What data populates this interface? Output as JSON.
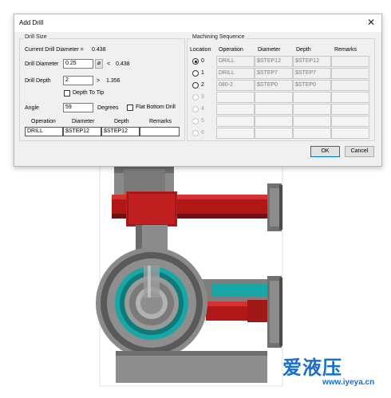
{
  "dialog": {
    "title": "Add Drill",
    "close_glyph": "✕",
    "drill_size": {
      "group_title": "Drill Size",
      "current_diameter_label": "Current Drill Diameter =",
      "current_diameter_value": "0.438",
      "drill_diameter_label": "Drill Diameter",
      "drill_diameter_value": "0.25",
      "diameter_button": "⌀",
      "diameter_compare": "<",
      "diameter_limit": "0.438",
      "drill_depth_label": "Drill Depth",
      "drill_depth_value": "2",
      "depth_compare": ">",
      "depth_limit": "1.356",
      "depth_to_tip_label": "Depth To Tip",
      "depth_to_tip_checked": false,
      "angle_label": "Angle",
      "angle_value": "59",
      "angle_unit": "Degrees",
      "flat_bottom_label": "Flat Bottom Drill",
      "flat_bottom_checked": false,
      "table": {
        "headers": [
          "Operation",
          "Diameter",
          "Depth",
          "Remarks"
        ],
        "row": [
          "DRILL",
          "$STEP12",
          "$STEP12",
          ""
        ]
      }
    },
    "sequence": {
      "group_title": "Machining Sequence",
      "headers": [
        "Location",
        "Operation",
        "Diameter",
        "Depth",
        "Remarks"
      ],
      "rows": [
        {
          "loc": "0",
          "operation": "DRILL",
          "diameter": "$STEP12",
          "depth": "$STEP12",
          "remarks": "",
          "selected": true,
          "enabled": true
        },
        {
          "loc": "1",
          "operation": "DRILL",
          "diameter": "$STEP7",
          "depth": "$STEP7",
          "remarks": "",
          "selected": false,
          "enabled": true
        },
        {
          "loc": "2",
          "operation": "080-2",
          "diameter": "$STEP0",
          "depth": "$STEP0",
          "remarks": "",
          "selected": false,
          "enabled": true
        },
        {
          "loc": "3",
          "operation": "",
          "diameter": "",
          "depth": "",
          "remarks": "",
          "selected": false,
          "enabled": false
        },
        {
          "loc": "4",
          "operation": "",
          "diameter": "",
          "depth": "",
          "remarks": "",
          "selected": false,
          "enabled": false
        },
        {
          "loc": "5",
          "operation": "",
          "diameter": "",
          "depth": "",
          "remarks": "",
          "selected": false,
          "enabled": false
        },
        {
          "loc": "6",
          "operation": "",
          "diameter": "",
          "depth": "",
          "remarks": "",
          "selected": false,
          "enabled": false
        }
      ]
    },
    "buttons": {
      "ok": "OK",
      "cancel": "Cancel"
    }
  },
  "viewport": {
    "colors": {
      "body": "#7e7e7e",
      "body_dark": "#5c5c5c",
      "red": "#b01818",
      "red_dark": "#701010",
      "teal": "#18a6a6",
      "green": "#1f5f33"
    }
  },
  "watermark": {
    "chinese": "爱液压",
    "url": "www.iyeya.cn",
    "color": "#1a6fc9"
  }
}
